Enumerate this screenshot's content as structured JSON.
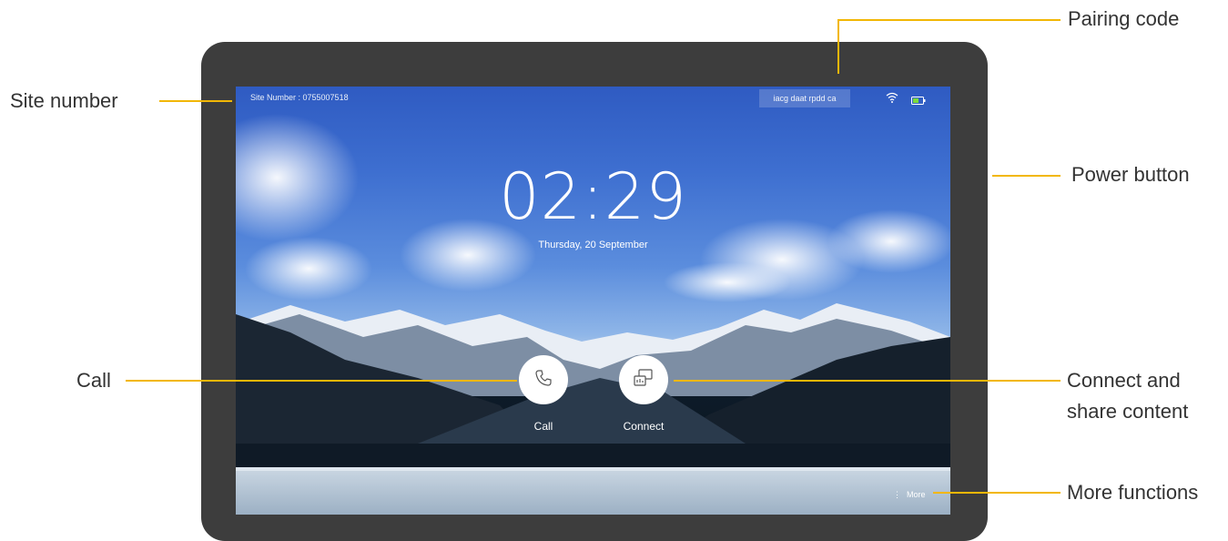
{
  "annotations": {
    "site_number": "Site number",
    "pairing_code": "Pairing code",
    "power_button": "Power button",
    "call": "Call",
    "connect_line1": "Connect and",
    "connect_line2": "share content",
    "more_functions": "More functions"
  },
  "screen": {
    "site_number_text": "Site Number : 0755007518",
    "pairing_code_value": "iacg daat rpdd ca",
    "time": "02:29",
    "date": "Thursday, 20 September",
    "call_label": "Call",
    "connect_label": "Connect",
    "more_label": "More"
  },
  "icons": {
    "wifi": "wifi-icon",
    "battery": "battery-icon",
    "phone": "phone-icon",
    "share": "share-screen-icon",
    "more": "vertical-dots-icon"
  },
  "colors": {
    "accent_line": "#f2b705",
    "device_frame": "#3d3d3d"
  }
}
